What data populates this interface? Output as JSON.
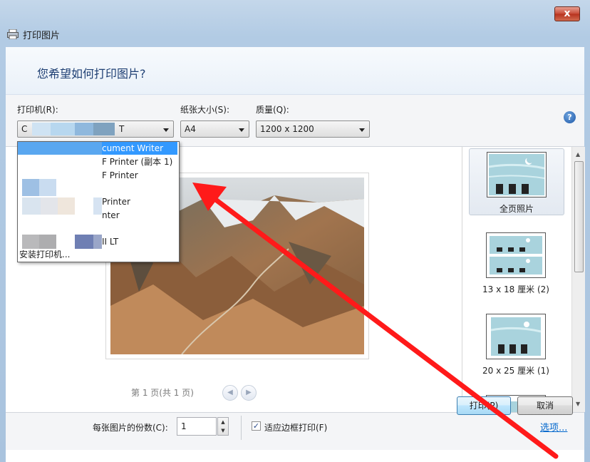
{
  "window": {
    "title": "打印图片",
    "close_glyph": "x"
  },
  "header": {
    "prompt": "您希望如何打印图片?"
  },
  "printer": {
    "label": "打印机(R):",
    "value_visible": "C",
    "value_suffix": "T",
    "options": [
      {
        "visible_text": "cument Writer",
        "highlighted": true
      },
      {
        "visible_text": "F Printer (副本 1)",
        "highlighted": false
      },
      {
        "visible_text": "F Printer",
        "highlighted": false
      },
      {
        "visible_text": "Printer",
        "highlighted": false
      },
      {
        "visible_text": "nter",
        "highlighted": false
      },
      {
        "visible_text": "II LT",
        "highlighted": false
      }
    ],
    "install_label": "安装打印机..."
  },
  "paper_size": {
    "label": "纸张大小(S):",
    "value": "A4"
  },
  "quality": {
    "label": "质量(Q):",
    "value": "1200 x 1200"
  },
  "help": {
    "glyph": "?"
  },
  "preview": {
    "page_status": "第 1 页(共 1 页)",
    "prev_glyph": "◀",
    "next_glyph": "▶"
  },
  "layouts": [
    {
      "label": "全页照片",
      "selected": true
    },
    {
      "label": "13 x 18 厘米 (2)",
      "selected": false
    },
    {
      "label": "20 x 25 厘米 (1)",
      "selected": false
    }
  ],
  "copies": {
    "label": "每张图片的份数(C):",
    "value": "1",
    "up_glyph": "▲",
    "down_glyph": "▼"
  },
  "fit_frame": {
    "label": "适应边框打印(F)",
    "checked": true,
    "check_glyph": "✓"
  },
  "options_link": "选项...",
  "buttons": {
    "print": "打印(P)",
    "cancel": "取消"
  },
  "colors": {
    "highlight": "#3399ff",
    "header_text": "#1e3f73",
    "link": "#0066cc",
    "annotation_arrow": "#ff1a1a"
  },
  "scrollbar_glyphs": {
    "up": "▲",
    "down": "▼"
  }
}
